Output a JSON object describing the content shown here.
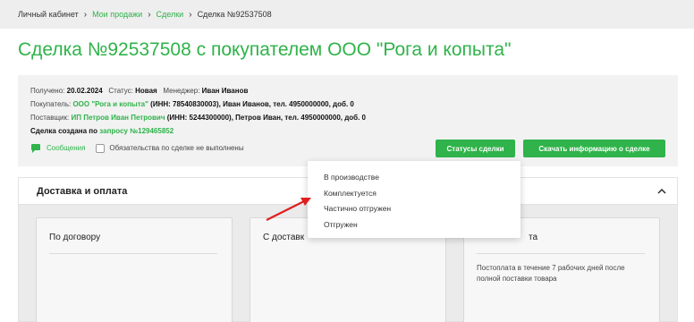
{
  "breadcrumb": {
    "items": [
      "Личный кабинет",
      "Мои продажи",
      "Сделки",
      "Сделка №92537508"
    ]
  },
  "page_title": "Сделка №92537508 с покупателем ООО \"Рога и копыта\"",
  "info": {
    "received_label": "Получено:",
    "received_value": "20.02.2024",
    "status_label": "Статус:",
    "status_value": "Новая",
    "manager_label": "Менеджер:",
    "manager_value": "Иван Иванов",
    "buyer_label": "Покупатель:",
    "buyer_name": "ООО \"Рога и копыта\"",
    "buyer_details": "(ИНН: 78540830003), Иван Иванов, тел. 4950000000, доб. 0",
    "supplier_label": "Поставщик:",
    "supplier_name": "ИП Петров Иван Петрович",
    "supplier_details": "(ИНН: 5244300000), Петров Иван, тел. 4950000000, доб. 0",
    "created_label": "Сделка создана по",
    "created_link": "запросу №129465852",
    "messages_label": "Сообщения",
    "obligation_label": "Обязательства по сделке не выполнены"
  },
  "buttons": {
    "statuses": "Статусы сделки",
    "download": "Скачать информацию о сделке"
  },
  "status_menu": {
    "options": [
      "В производстве",
      "Комплектуется",
      "Частично отгружен",
      "Отгружен"
    ]
  },
  "section": {
    "title": "Доставка и оплата",
    "cards": [
      {
        "title": "По договору",
        "desc": ""
      },
      {
        "title": "С доставк",
        "desc": ""
      },
      {
        "title": "та",
        "desc": "Постоплата в течение 7 рабочих дней после полной поставки товара"
      }
    ]
  },
  "colors": {
    "accent": "#2fb34a",
    "arrow": "#e02020"
  }
}
